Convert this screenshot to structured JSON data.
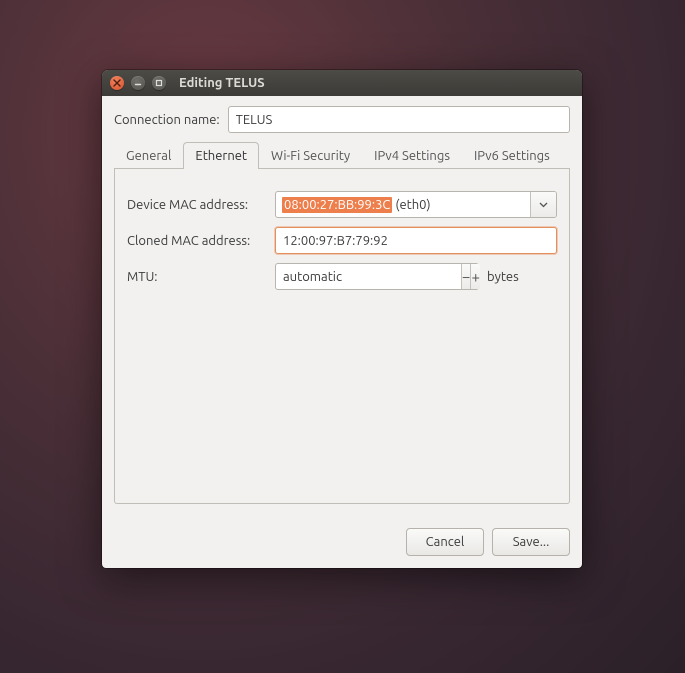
{
  "window": {
    "title": "Editing TELUS"
  },
  "connection": {
    "label": "Connection name:",
    "value": "TELUS"
  },
  "tabs": {
    "general": "General",
    "ethernet": "Ethernet",
    "wifi_security": "Wi-Fi Security",
    "ipv4": "IPv4 Settings",
    "ipv6": "IPv6 Settings"
  },
  "form": {
    "device_mac_label": "Device MAC address:",
    "device_mac_selected": "08:00:27:BB:99:3C",
    "device_mac_iface": "(eth0)",
    "cloned_mac_label": "Cloned MAC address:",
    "cloned_mac_value": "12:00:97:B7:79:92",
    "mtu_label": "MTU:",
    "mtu_value": "automatic",
    "mtu_unit": "bytes"
  },
  "buttons": {
    "cancel": "Cancel",
    "save": "Save..."
  }
}
